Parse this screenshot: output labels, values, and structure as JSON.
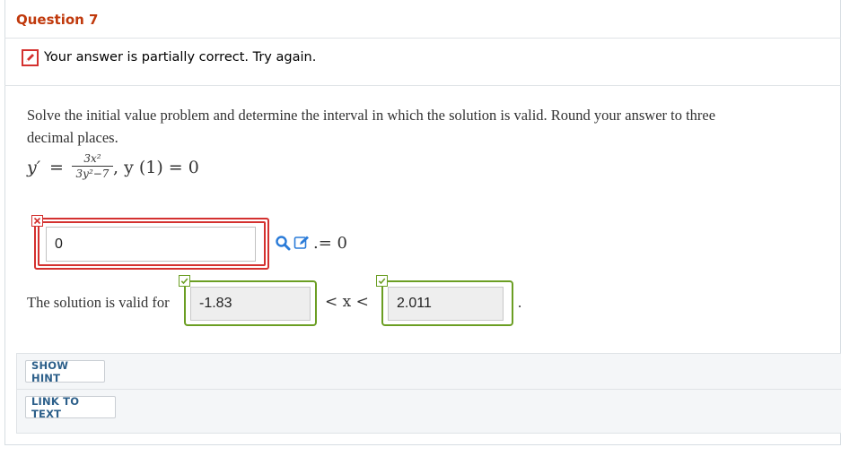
{
  "question": {
    "title": "Question 7"
  },
  "feedback": {
    "message": "Your answer is partially correct.  Try again."
  },
  "problem": {
    "prompt": "Solve the initial value problem and determine the interval in which the solution is valid. Round your answer to three decimal places.",
    "equation": {
      "lhs": "y′",
      "equals": "=",
      "numerator": "3x²",
      "denominator": "3y²−7",
      "condition": ",  y (1) = 0"
    }
  },
  "answer1": {
    "value": "0",
    "status": "incorrect",
    "equals_zero": ".= 0"
  },
  "interval": {
    "label": "The solution is valid for",
    "lower": "-1.83",
    "lower_status": "correct",
    "inequality": "< x <",
    "upper": "2.011",
    "upper_status": "correct",
    "period": "."
  },
  "buttons": {
    "show_hint": "SHOW HINT",
    "link_to_text": "LINK TO TEXT"
  },
  "colors": {
    "title": "#c0390c",
    "error": "#d4312f",
    "correct": "#6b9e23",
    "link": "#2c5f8a",
    "tool_icon": "#2a7bd8"
  },
  "icons": [
    "pencil-icon",
    "x-mark-icon",
    "search-icon",
    "edit-icon",
    "checkmark-icon"
  ]
}
